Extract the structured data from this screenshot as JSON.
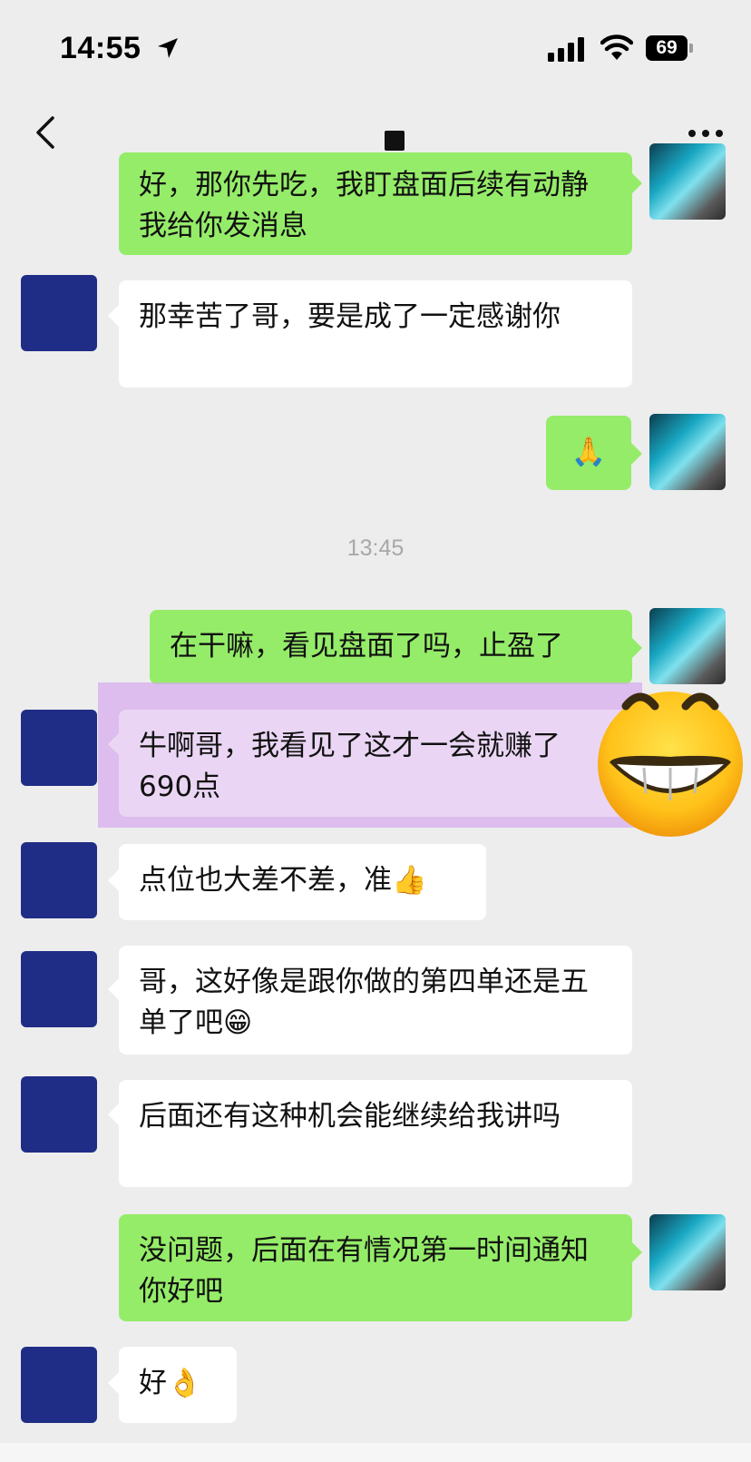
{
  "status_bar": {
    "time": "14:55",
    "battery_level": "69"
  },
  "nav": {
    "back_icon": "chevron-left-icon",
    "more_icon": "more-dots-icon"
  },
  "timestamp": "13:45",
  "messages": [
    {
      "side": "right",
      "text": "好，那你先吃，我盯盘面后续有动静我给你发消息"
    },
    {
      "side": "left",
      "text": "那幸苦了哥，要是成了一定感谢你"
    },
    {
      "side": "right",
      "text": "🙏"
    },
    {
      "side": "right",
      "text": "在干嘛，看见盘面了吗，止盈了"
    },
    {
      "side": "left",
      "text": "牛啊哥，我看见了这才一会就赚了690点"
    },
    {
      "side": "left",
      "text": "点位也大差不差，准👍"
    },
    {
      "side": "left",
      "text": "哥，这好像是跟你做的第四单还是五单了吧😁"
    },
    {
      "side": "left",
      "text": "后面还有这种机会能继续给我讲吗"
    },
    {
      "side": "right",
      "text": "没问题，后面在有情况第一时间通知你好吧"
    },
    {
      "side": "left",
      "text": "好👌"
    }
  ],
  "colors": {
    "background": "#ededed",
    "bubble_green": "#95ec69",
    "bubble_white": "#ffffff",
    "highlight": "#d6acec"
  }
}
